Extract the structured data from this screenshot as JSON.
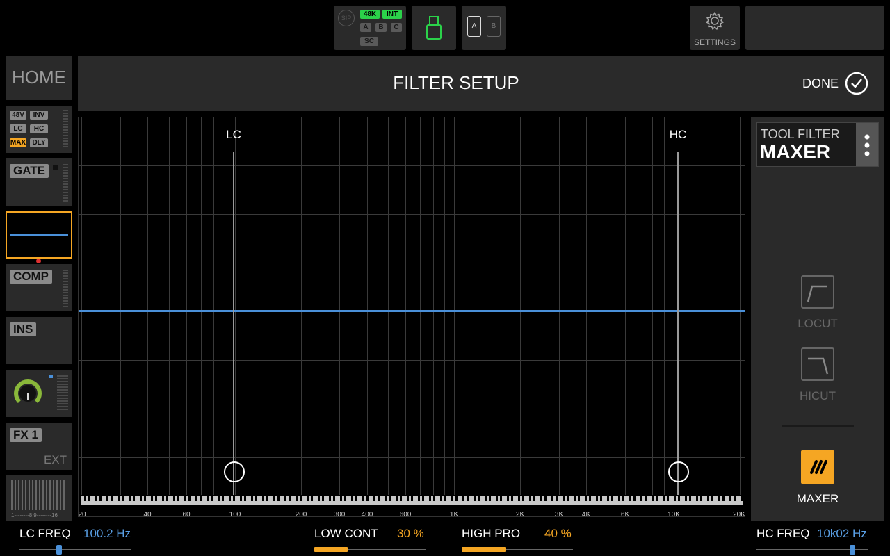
{
  "topbar": {
    "sip_label": "SIP",
    "chips": {
      "k48": "48K",
      "int": "INT",
      "a": "A",
      "b": "B",
      "c": "C",
      "sc": "SC"
    },
    "card_a": "A",
    "card_b": "B",
    "settings_label": "SETTINGS"
  },
  "sidebar": {
    "home": "HOME",
    "preamp_chips": [
      "48V",
      "INV",
      "LC",
      "HC",
      "MAX",
      "DLY"
    ],
    "gate": "GATE",
    "comp": "COMP",
    "ins": "INS",
    "fx": "FX 1",
    "fx_sub": "EXT",
    "meter_scale": "1--------8|9--------16"
  },
  "header": {
    "title": "FILTER SETUP",
    "done": "DONE"
  },
  "graph": {
    "lc_label": "LC",
    "hc_label": "HC",
    "x_ticks": [
      "20",
      "40",
      "60",
      "100",
      "200",
      "300",
      "400",
      "600",
      "1K",
      "2K",
      "3K",
      "4K",
      "6K",
      "10K",
      "20K"
    ],
    "curve_color": "#4a90d9"
  },
  "right_panel": {
    "tool_label": "TOOL FILTER",
    "tool_value": "MAXER",
    "locut": "LOCUT",
    "hicut": "HICUT",
    "maxer": "MAXER",
    "accent": "#f5a623"
  },
  "bottom": {
    "lc_freq_label": "LC FREQ",
    "lc_freq_value": "100.2 Hz",
    "low_cont_label": "LOW CONT",
    "low_cont_value": "30 %",
    "high_pro_label": "HIGH PRO",
    "high_pro_value": "40 %",
    "hc_freq_label": "HC FREQ",
    "hc_freq_value": "10k02 Hz",
    "low_cont_level": 0.3,
    "high_pro_level": 0.4
  }
}
